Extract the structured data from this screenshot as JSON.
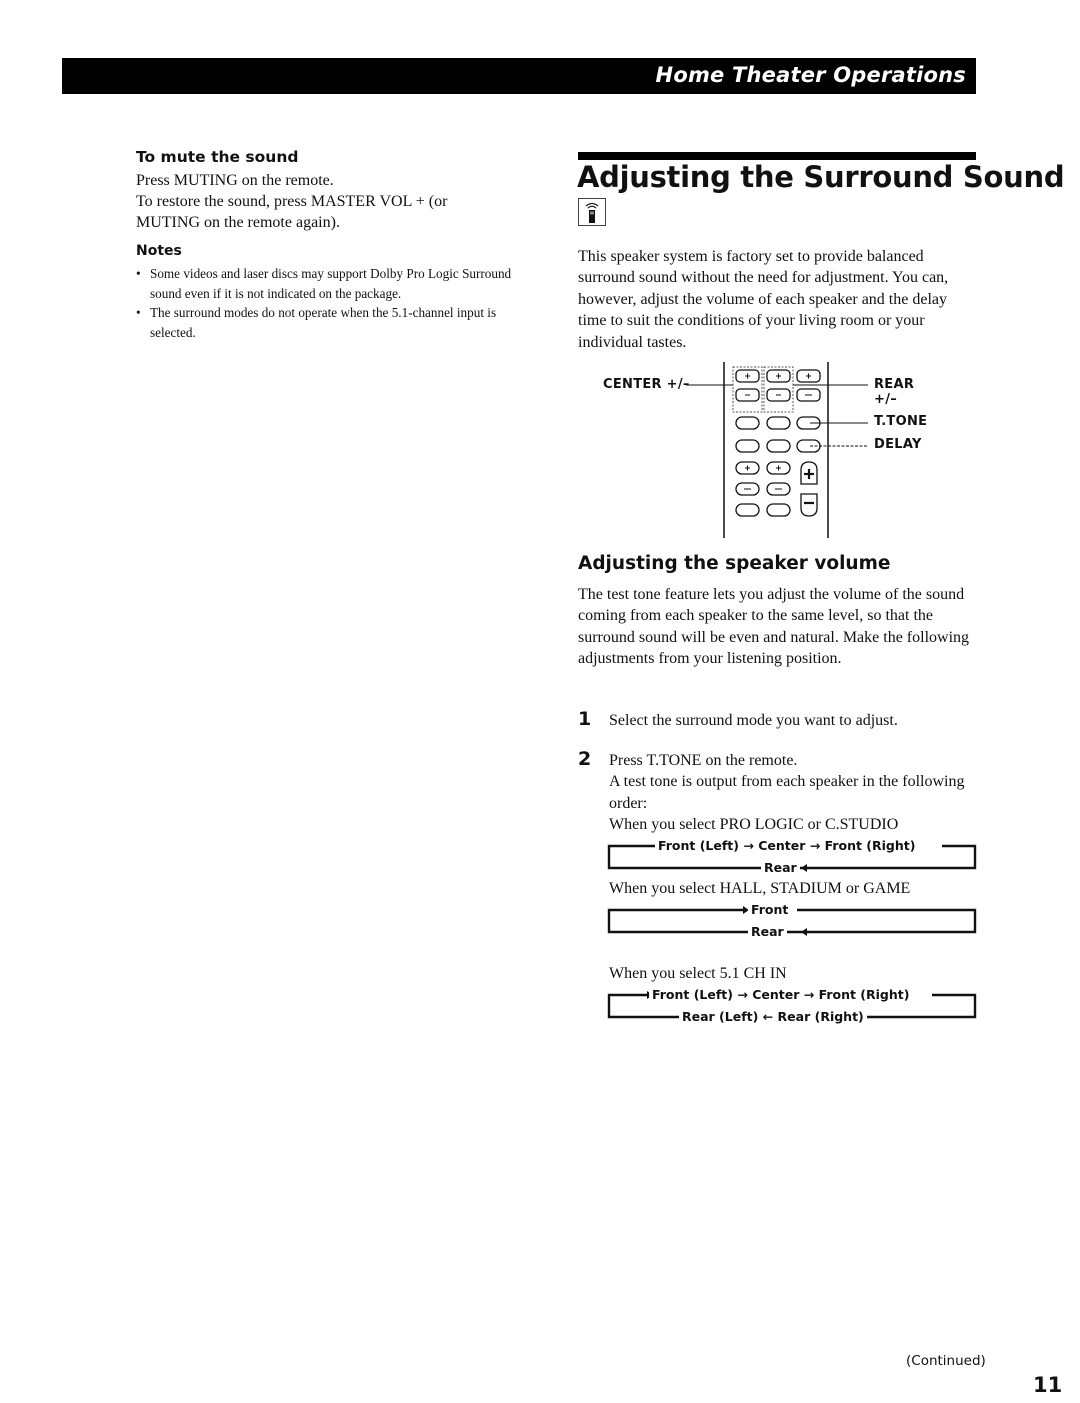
{
  "header": {
    "section_title": "Home Theater Operations"
  },
  "left_column": {
    "mute": {
      "heading": "To mute the sound",
      "paragraph1": "Press MUTING on the remote.",
      "paragraph2": "To restore the sound, press MASTER VOL + (or MUTING on the remote again)."
    },
    "notes": {
      "heading": "Notes",
      "items": [
        "Some videos and laser discs may support Dolby Pro Logic Surround sound even if it is not indicated on the package.",
        "The surround modes do not operate when the 5.1-channel input is selected."
      ],
      "bullet": "•"
    }
  },
  "right_column": {
    "title": "Adjusting the Surround Sound",
    "title_icon": "remote-control-icon",
    "intro": "This speaker system is factory set to provide balanced surround sound without the need for adjustment.  You can, however, adjust the volume of each speaker and the delay time to suit the conditions of your living room or your individual tastes.",
    "diagram": {
      "labels": {
        "center": "CENTER +/–",
        "rear": "REAR +/–",
        "ttone": "T.TONE",
        "delay": "DELAY"
      },
      "button_symbols": {
        "plus": "+",
        "minus": "–"
      }
    },
    "speaker_volume": {
      "heading": "Adjusting the speaker volume",
      "paragraph": "The test tone feature lets you adjust the volume of the sound coming from each speaker to the same level, so that the surround sound will be even and natural. Make the following adjustments from your listening position."
    },
    "steps": [
      {
        "number": "1",
        "text": "Select the surround mode you want to adjust."
      },
      {
        "number": "2",
        "text": "Press T.TONE on the remote.\nA test tone is output from each speaker in the following order:"
      }
    ],
    "modes": [
      {
        "label": "When you select PRO LOGIC or C.STUDIO",
        "top_row": [
          "Front (Left)",
          "Center",
          "Front (Right)"
        ],
        "bottom_row": [
          "Rear"
        ]
      },
      {
        "label": "When you select HALL, STADIUM or GAME",
        "top_row": [
          "Front"
        ],
        "bottom_row": [
          "Rear"
        ]
      },
      {
        "label": "When you select 5.1 CH IN",
        "top_row": [
          "Front (Left)",
          "Center",
          "Front (Right)"
        ],
        "bottom_row": [
          "Rear (Left)",
          "Rear (Right)"
        ]
      }
    ],
    "arrow_right": "→",
    "arrow_left": "←"
  },
  "footer": {
    "continued": "(Continued)",
    "page_number": "11"
  }
}
